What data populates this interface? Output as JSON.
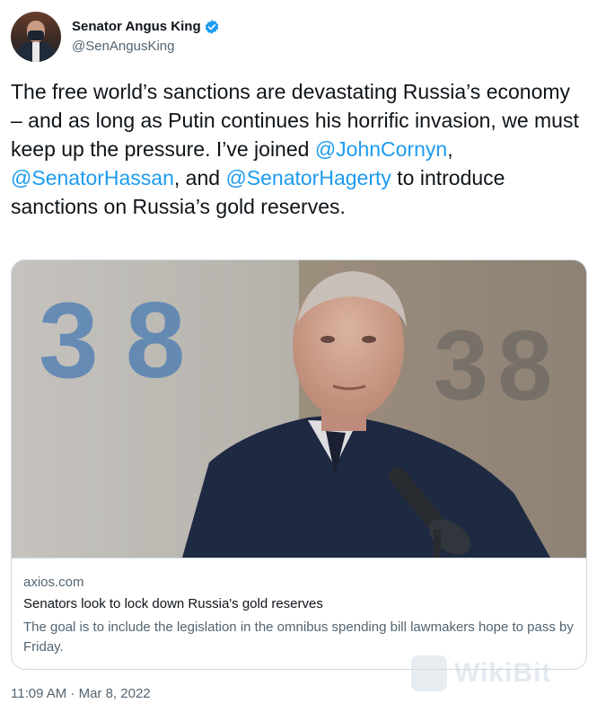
{
  "author": {
    "display_name": "Senator Angus King",
    "handle": "@SenAngusKing",
    "verified": true
  },
  "tweet": {
    "text_1": "The free world’s sanctions are devastating Russia’s economy – and as long as Putin continues his horrific invasion, we must keep up the pressure. I’ve joined ",
    "mention_1": "@JohnCornyn",
    "text_2": ", ",
    "mention_2": "@SenatorHassan",
    "text_3": ", and ",
    "mention_3": "@SenatorHagerty",
    "text_4": " to introduce sanctions on Russia’s gold reserves."
  },
  "card": {
    "domain": "axios.com",
    "title": "Senators look to lock down Russia's gold reserves",
    "description": "The goal is to include the legislation in the omnibus spending bill lawmakers hope to pass by Friday.",
    "wall_digits_left": "38",
    "wall_digits_right": "38"
  },
  "timestamp": "11:09 AM · Mar 8, 2022",
  "watermark": "WikiBit",
  "colors": {
    "link": "#1d9bf0",
    "secondary_text": "#536471",
    "border": "#cfd9de"
  }
}
